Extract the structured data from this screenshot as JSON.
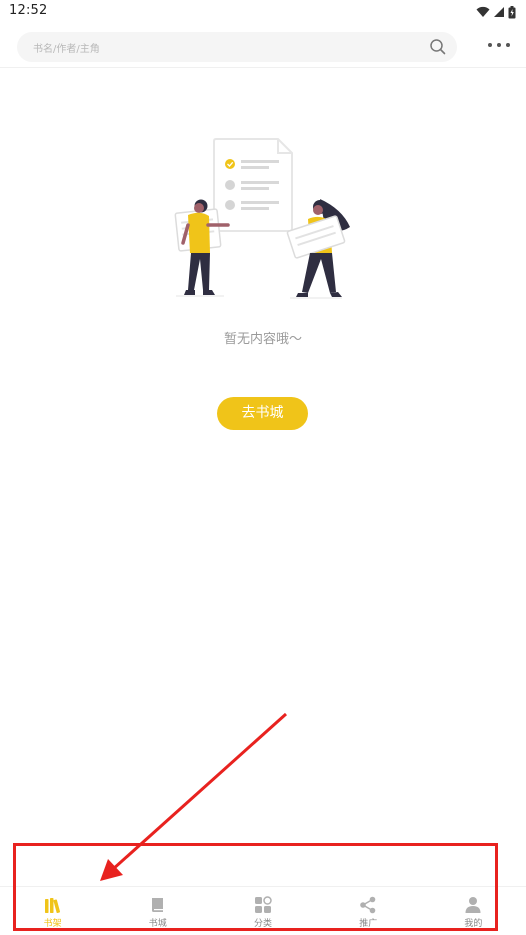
{
  "status_bar": {
    "time": "12:52"
  },
  "search": {
    "placeholder": "书名/作者/主角"
  },
  "empty_state": {
    "message": "暂无内容哦～",
    "button_label": "去书城"
  },
  "bottom_nav": {
    "items": [
      {
        "label": "书架",
        "icon": "bookshelf-icon",
        "active": true
      },
      {
        "label": "书城",
        "icon": "book-icon",
        "active": false
      },
      {
        "label": "分类",
        "icon": "category-icon",
        "active": false
      },
      {
        "label": "推广",
        "icon": "share-icon",
        "active": false
      },
      {
        "label": "我的",
        "icon": "user-icon",
        "active": false
      }
    ]
  },
  "colors": {
    "accent": "#f0c419",
    "annotation": "#e8221f",
    "inactive_icon": "#b0b0b0"
  }
}
